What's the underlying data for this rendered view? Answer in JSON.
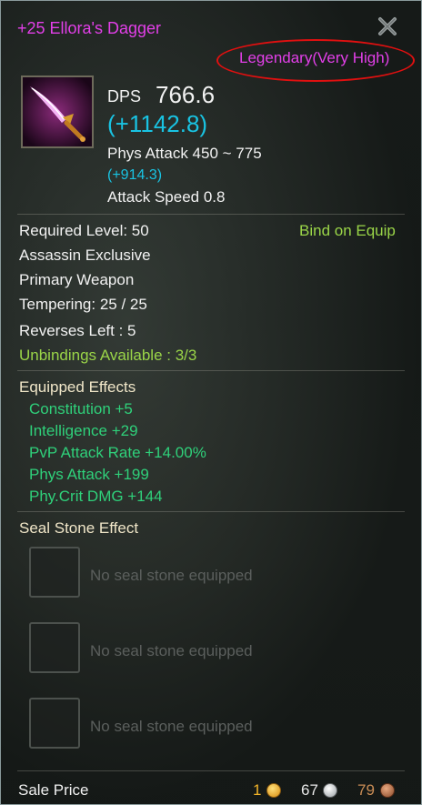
{
  "item": {
    "title": "+25 Ellora's Dagger",
    "rarity": "Legendary(Very High)",
    "dps_label": "DPS",
    "dps_value": "766.6",
    "dps_bonus": "(+1142.8)",
    "phys_attack": "Phys Attack 450 ~ 775",
    "phys_attack_bonus": "(+914.3)",
    "attack_speed": "Attack Speed 0.8",
    "required_level": "Required Level: 50",
    "bind": "Bind on Equip",
    "class_exclusive": "Assassin Exclusive",
    "weapon_type": "Primary Weapon",
    "tempering": "Tempering: 25 / 25",
    "reverses_left": "Reverses Left : 5",
    "unbindings": "Unbindings Available : 3/3"
  },
  "equipped_effects": {
    "title": "Equipped Effects",
    "items": [
      "Constitution +5",
      "Intelligence +29",
      "PvP Attack Rate +14.00%",
      "Phys Attack +199",
      "Phy.Crit DMG +144"
    ]
  },
  "seal_stones": {
    "title": "Seal Stone Effect",
    "slots": [
      "No seal stone equipped",
      "No seal stone equipped",
      "No seal stone equipped"
    ]
  },
  "sale": {
    "label": "Sale Price",
    "gold": "1",
    "silver": "67",
    "bronze": "79"
  },
  "colors": {
    "legendary": "#e23fe8",
    "bonus": "#19c3e2",
    "effect": "#2fd07a",
    "bind": "#9ad548"
  },
  "icons": {
    "close": "close-x-icon",
    "item": "dagger-icon",
    "currency": [
      "gold-coin-icon",
      "silver-coin-icon",
      "bronze-coin-icon"
    ]
  }
}
